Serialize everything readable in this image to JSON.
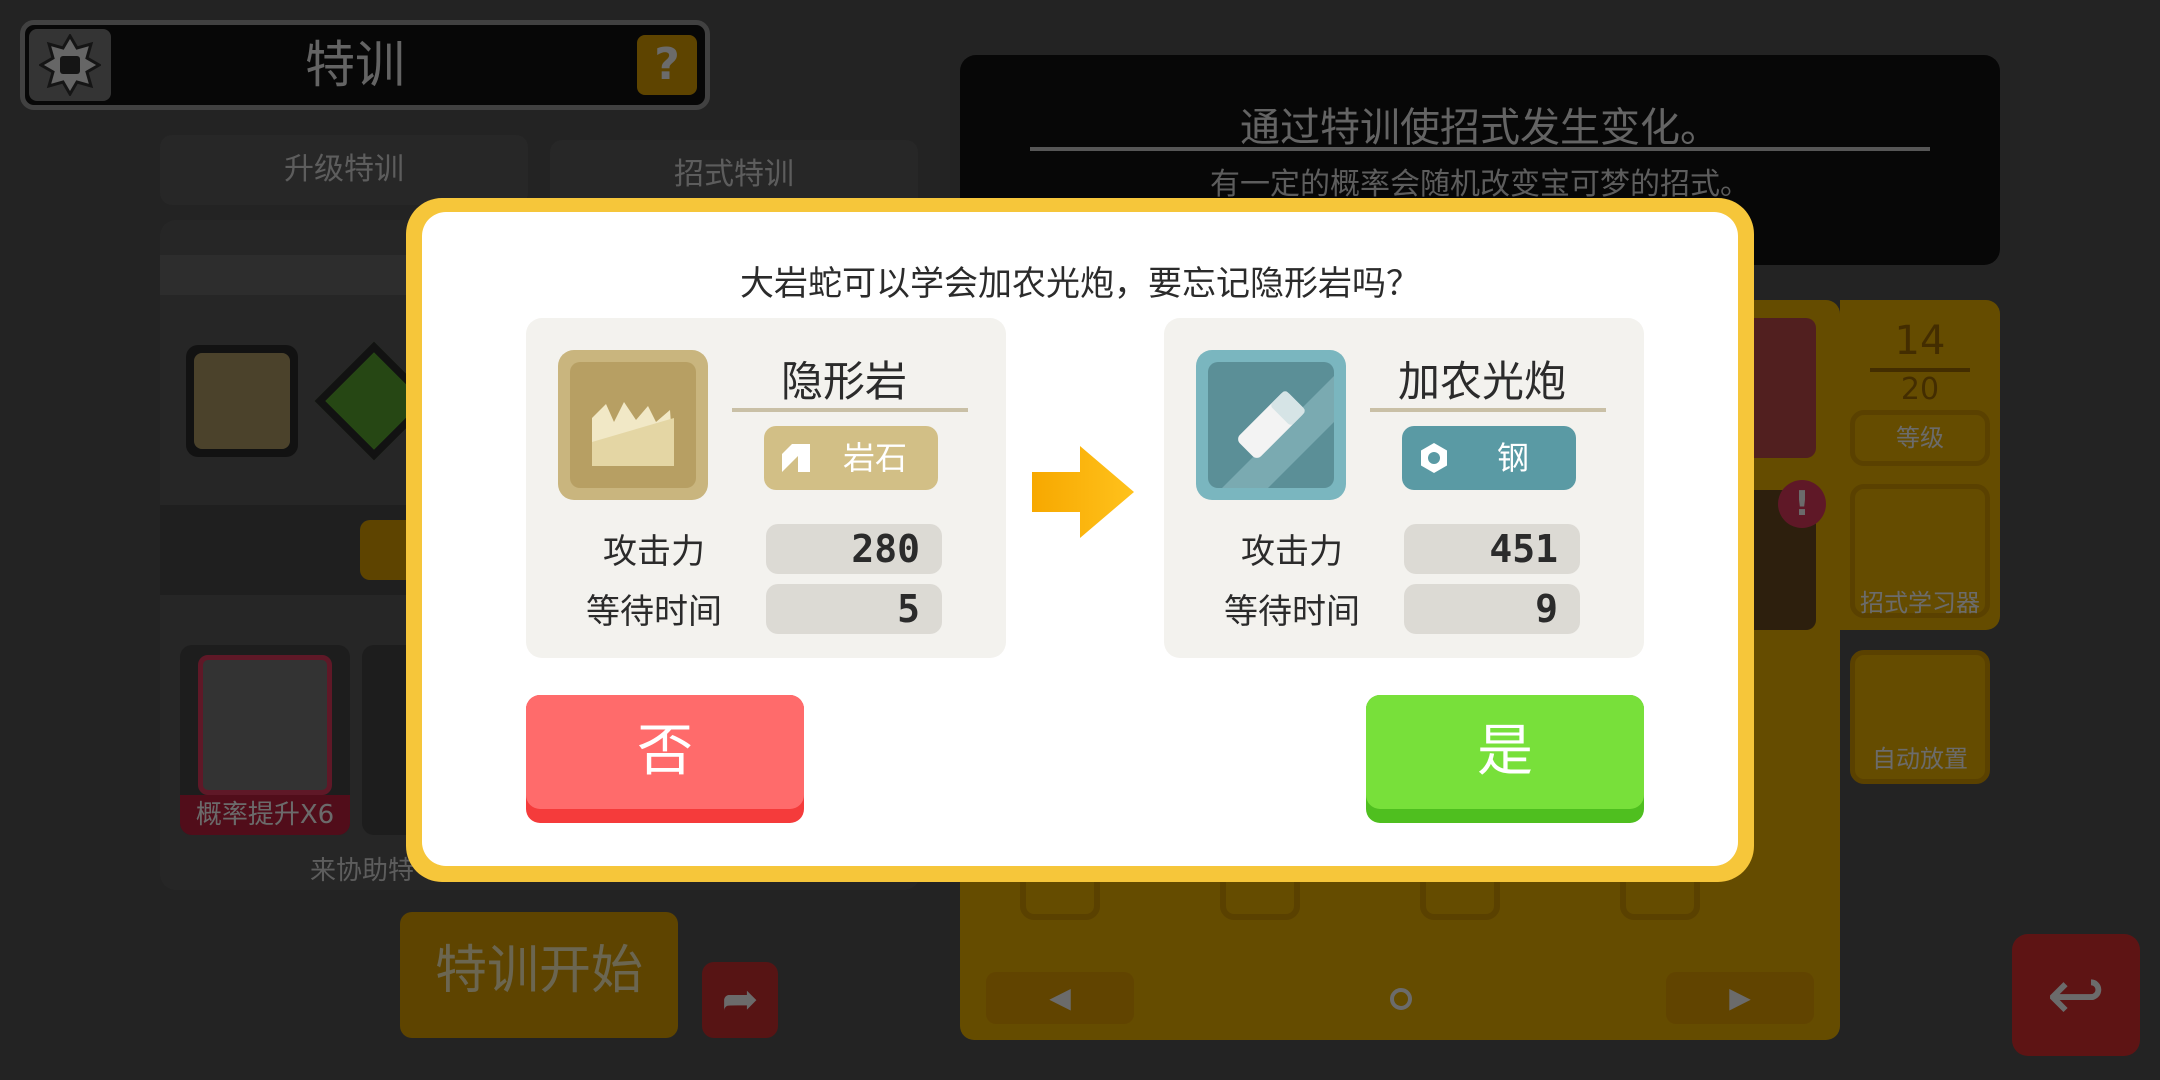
{
  "background": {
    "header": {
      "title": "特训",
      "help_icon": "question-icon"
    },
    "tabs": [
      "升级特训",
      "招式特训"
    ],
    "helper_badge": "概率提升X6",
    "assist_text": "来协助特",
    "start_button": "特训开始",
    "info": {
      "title": "通过特训使招式发生变化。",
      "subtitle": "有一定的概率会随机改变宝可梦的招式。"
    },
    "level": {
      "current": "14",
      "max": "20",
      "label": "等级"
    },
    "move_learner_label": "招式学习器",
    "auto_place_label": "自动放置",
    "nav": {
      "prev": "◀",
      "next": "▶"
    },
    "alert": "!"
  },
  "dialog": {
    "question": "大岩蛇可以学会加农光炮，要忘记隐形岩吗？",
    "stat_labels": {
      "attack": "攻击力",
      "wait": "等待时间"
    },
    "old_move": {
      "name": "隐形岩",
      "type": "岩石",
      "attack": "280",
      "wait": "5",
      "icon": "stealth-rock-icon",
      "type_icon": "rock-type-icon",
      "colors": {
        "icon_bg": "#c9b57e",
        "icon_inner": "#b79f63",
        "pill": "#d2bf86"
      }
    },
    "new_move": {
      "name": "加农光炮",
      "type": "钢",
      "attack": "451",
      "wait": "9",
      "icon": "flash-cannon-icon",
      "type_icon": "steel-type-icon",
      "colors": {
        "icon_bg": "#7ab6bf",
        "icon_inner": "#5b8f97",
        "pill": "#5a9aa4"
      }
    },
    "no_label": "否",
    "yes_label": "是"
  }
}
